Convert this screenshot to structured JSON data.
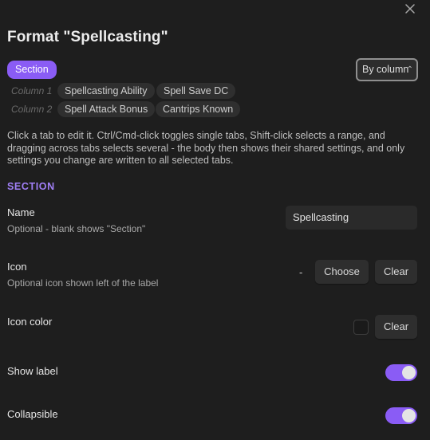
{
  "dialog": {
    "title": "Format \"Spellcasting\""
  },
  "tabs": {
    "section_label": "Section",
    "rows": [
      {
        "label": "Column 1",
        "tabs": [
          "Spellcasting Ability",
          "Spell Save DC"
        ]
      },
      {
        "label": "Column 2",
        "tabs": [
          "Spell Attack Bonus",
          "Cantrips Known"
        ]
      }
    ]
  },
  "layout_select": {
    "value": "By column"
  },
  "help_text": "Click a tab to edit it. Ctrl/Cmd-click toggles single tabs, Shift-click selects a range, and dragging across tabs selects several - the body then shows their shared settings, and only settings you change are written to all selected tabs.",
  "section_heading": "SECTION",
  "settings": {
    "name": {
      "label": "Name",
      "desc": "Optional - blank shows \"Section\"",
      "value": "Spellcasting"
    },
    "icon": {
      "label": "Icon",
      "desc": "Optional icon shown left of the label",
      "current": "-",
      "choose_label": "Choose",
      "clear_label": "Clear"
    },
    "icon_color": {
      "label": "Icon color",
      "clear_label": "Clear"
    },
    "show_label": {
      "label": "Show label",
      "enabled": true
    },
    "collapsible": {
      "label": "Collapsible",
      "enabled": true
    }
  },
  "colors": {
    "accent": "#8a5cf5",
    "heading": "#a07ff5",
    "background": "#1e1e1e"
  },
  "icons": {
    "close": "close-icon",
    "dropdown": "chevron-updown-icon"
  }
}
